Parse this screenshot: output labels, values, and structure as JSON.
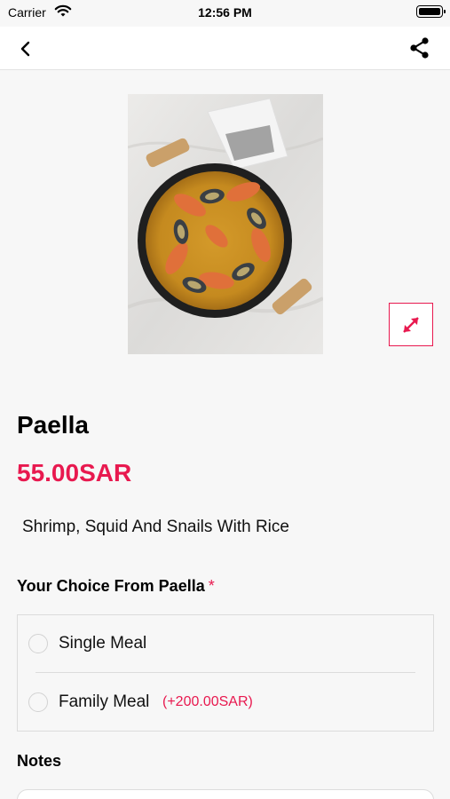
{
  "status_bar": {
    "carrier": "Carrier",
    "time": "12:56 PM",
    "icons": [
      "wifi-icon",
      "battery-icon"
    ]
  },
  "nav": {
    "back_icon": "chevron-left-icon",
    "share_icon": "share-icon"
  },
  "product": {
    "image": "paella-dish-photo",
    "expand_icon": "expand-arrows-icon",
    "name": "Paella",
    "price": "55.00SAR",
    "description": "Shrimp, Squid And Snails With Rice"
  },
  "choice": {
    "label": "Your Choice From Paella",
    "required_marker": "*",
    "options": [
      {
        "label": "Single Meal",
        "extra": "",
        "selected": false
      },
      {
        "label": "Family Meal",
        "extra": "(+200.00SAR)",
        "selected": false
      }
    ]
  },
  "notes": {
    "label": "Notes",
    "value": ""
  },
  "colors": {
    "accent": "#e8194f",
    "background": "#f7f7f7",
    "border": "#dcdcdc"
  }
}
